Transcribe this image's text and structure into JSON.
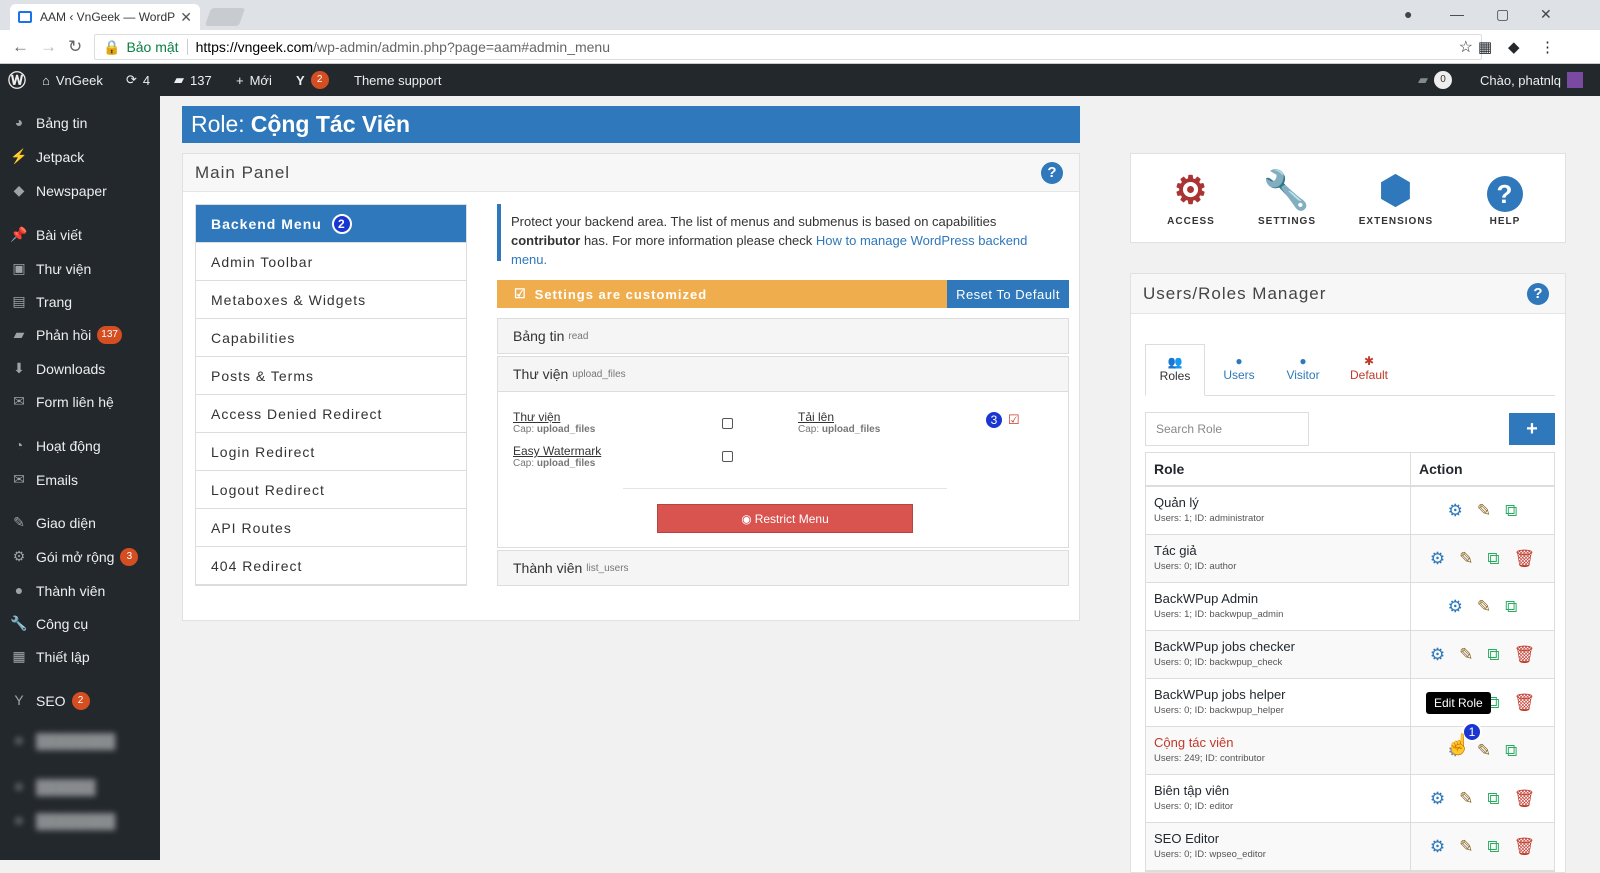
{
  "browser": {
    "tab_title": "AAM ‹ VnGeek — WordP",
    "secure_label": "Bảo mật",
    "url_host": "https://vngeek.com",
    "url_path": "/wp-admin/admin.php?page=aam#admin_menu"
  },
  "adminbar": {
    "site_name": "VnGeek",
    "updates": "4",
    "comments": "137",
    "new_label": "Mới",
    "yoast_count": "2",
    "theme_support": "Theme support",
    "notif_count": "0",
    "greeting": "Chào, phatnlq"
  },
  "sidebar": {
    "items": [
      {
        "label": "Bảng tin",
        "icon": "dashboard-icon"
      },
      {
        "label": "Jetpack",
        "icon": "jetpack-icon"
      },
      {
        "label": "Newspaper",
        "icon": "newspaper-icon"
      },
      {
        "label": "Bài viết",
        "icon": "pin-icon"
      },
      {
        "label": "Thư viện",
        "icon": "media-icon"
      },
      {
        "label": "Trang",
        "icon": "page-icon"
      },
      {
        "label": "Phản hồi",
        "icon": "comment-icon",
        "badge": "137"
      },
      {
        "label": "Downloads",
        "icon": "download-icon"
      },
      {
        "label": "Form liên hệ",
        "icon": "mail-icon"
      },
      {
        "label": "Hoạt động",
        "icon": "activity-icon"
      },
      {
        "label": "Emails",
        "icon": "mail-icon"
      },
      {
        "label": "Giao diện",
        "icon": "brush-icon"
      },
      {
        "label": "Gói mở rộng",
        "icon": "plugin-icon",
        "badge": "3"
      },
      {
        "label": "Thành viên",
        "icon": "user-icon"
      },
      {
        "label": "Công cụ",
        "icon": "wrench-icon"
      },
      {
        "label": "Thiết lập",
        "icon": "settings-icon"
      },
      {
        "label": "SEO",
        "icon": "yoast-icon",
        "badge": "2"
      }
    ]
  },
  "page": {
    "title_prefix": "Role:",
    "title_role": "Cộng Tác Viên"
  },
  "main_panel": {
    "heading": "Main Panel",
    "menu": [
      "Backend Menu",
      "Admin Toolbar",
      "Metaboxes & Widgets",
      "Capabilities",
      "Posts & Terms",
      "Access Denied Redirect",
      "Login Redirect",
      "Logout Redirect",
      "API Routes",
      "404 Redirect"
    ],
    "step2": "2",
    "info_text_1": "Protect your backend area. The list of menus and submenus is based on capabilities",
    "info_bold": "contributor",
    "info_text_2": "has. For more information please check",
    "info_link": "How to manage WordPress backend menu.",
    "customized": "Settings are customized",
    "reset": "Reset To Default",
    "accordions": [
      {
        "name": "Bảng tin",
        "cap": "read"
      },
      {
        "name": "Thư viện",
        "cap": "upload_files"
      },
      {
        "name": "Thành viên",
        "cap": "list_users"
      }
    ],
    "items": [
      {
        "name": "Thư viện",
        "cap_label": "Cap:",
        "cap": "upload_files"
      },
      {
        "name": "Tải lên",
        "cap_label": "Cap:",
        "cap": "upload_files"
      },
      {
        "name": "Easy Watermark",
        "cap_label": "Cap:",
        "cap": "upload_files"
      }
    ],
    "step3": "3",
    "restrict": "Restrict Menu"
  },
  "tools": [
    {
      "label": "ACCESS",
      "icon": "gears-icon"
    },
    {
      "label": "SETTINGS",
      "icon": "wrench-icon"
    },
    {
      "label": "EXTENSIONS",
      "icon": "cubes-icon"
    },
    {
      "label": "HELP",
      "icon": "question-icon"
    }
  ],
  "manager": {
    "heading": "Users/Roles Manager",
    "tabs": [
      "Roles",
      "Users",
      "Visitor",
      "Default"
    ],
    "search_placeholder": "Search Role",
    "col_role": "Role",
    "col_action": "Action",
    "roles": [
      {
        "name": "Quản lý",
        "meta": "Users: 1; ID: administrator"
      },
      {
        "name": "Tác giả",
        "meta": "Users: 0; ID: author"
      },
      {
        "name": "BackWPup Admin",
        "meta": "Users: 1; ID: backwpup_admin"
      },
      {
        "name": "BackWPup jobs checker",
        "meta": "Users: 0; ID: backwpup_check"
      },
      {
        "name": "BackWPup jobs helper",
        "meta": "Users: 0; ID: backwpup_helper"
      },
      {
        "name": "Cộng tác viên",
        "meta": "Users: 249; ID: contributor"
      },
      {
        "name": "Biên tập viên",
        "meta": "Users: 0; ID: editor"
      },
      {
        "name": "SEO Editor",
        "meta": "Users: 0; ID: wpseo_editor"
      }
    ],
    "tooltip": "Edit Role",
    "step1": "1"
  }
}
